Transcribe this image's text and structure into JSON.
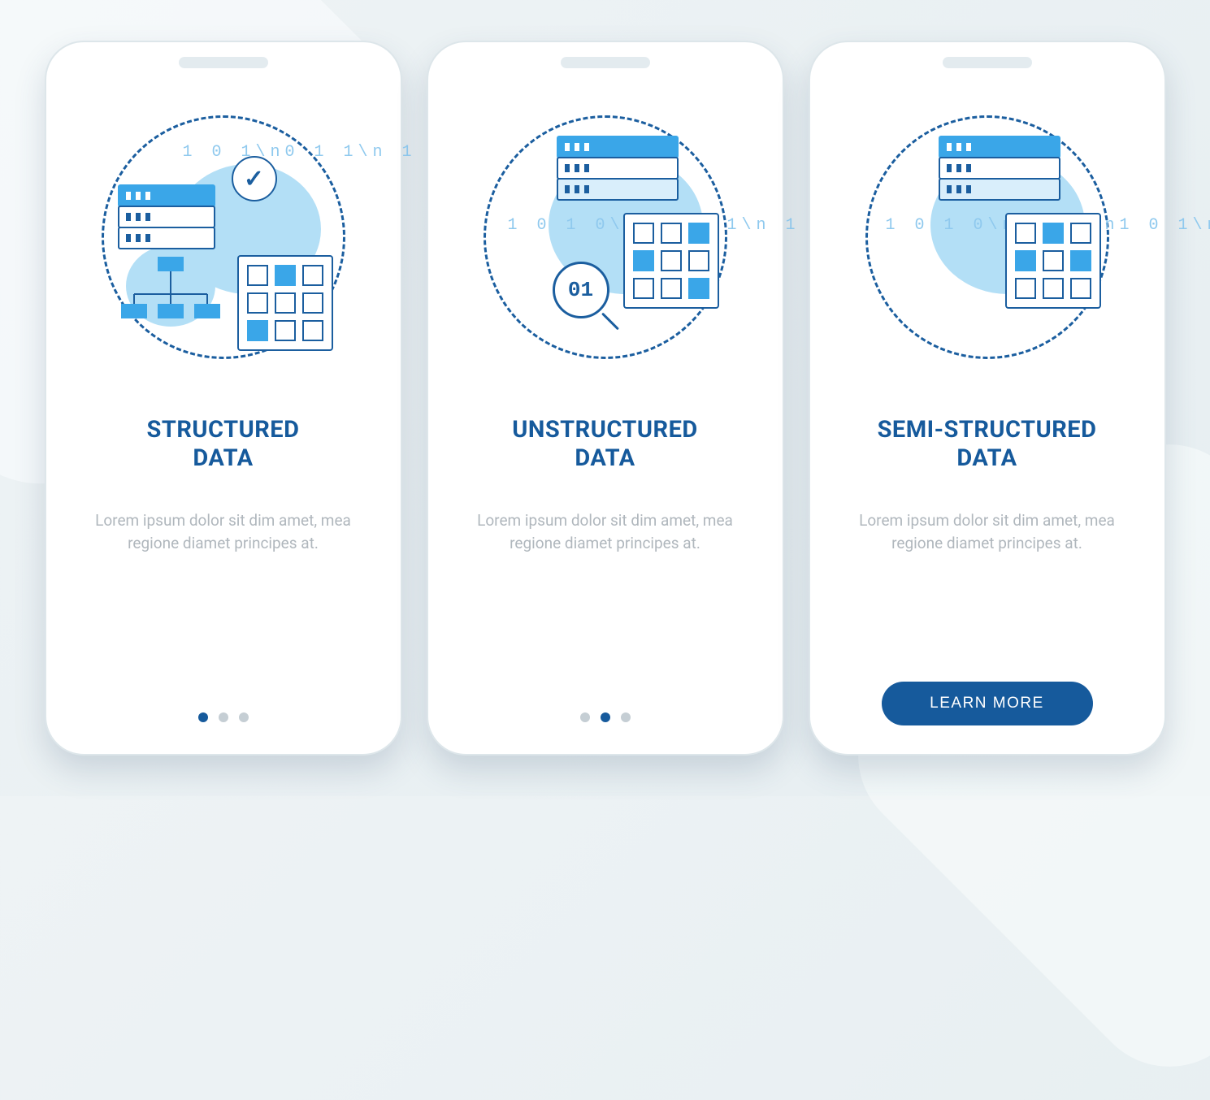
{
  "screens": [
    {
      "title": "STRUCTURED\nDATA",
      "description": "Lorem ipsum dolor sit dim amet, mea regione diamet principes at.",
      "activeDot": 0,
      "hasButton": false,
      "icon": "structured-data-icon"
    },
    {
      "title": "UNSTRUCTURED\nDATA",
      "description": "Lorem ipsum dolor sit dim amet, mea regione diamet principes at.",
      "activeDot": 1,
      "hasButton": false,
      "icon": "unstructured-data-icon"
    },
    {
      "title": "SEMI-STRUCTURED\nDATA",
      "description": "Lorem ipsum dolor sit dim amet, mea regione diamet principes at.",
      "activeDot": 2,
      "hasButton": true,
      "icon": "semi-structured-data-icon"
    }
  ],
  "button": {
    "label": "LEARN MORE"
  },
  "colors": {
    "accent": "#165a9c",
    "light": "#b3dff6"
  }
}
